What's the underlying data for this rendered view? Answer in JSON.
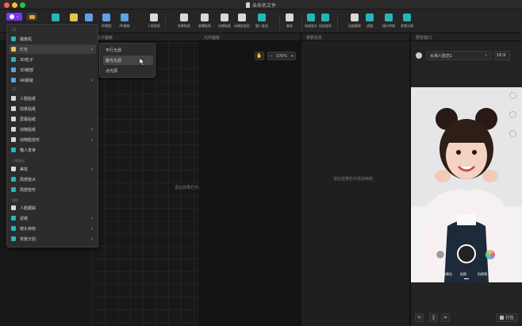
{
  "window": {
    "title": "未命名文件"
  },
  "toolbar": {
    "items": [
      {
        "label": "",
        "color": "#27b6b8"
      },
      {
        "label": "",
        "color": "#e0c64f"
      },
      {
        "label": "3D对象",
        "color": "#5fa0e6"
      },
      {
        "label": "3D模型",
        "color": "#5fa0e6"
      },
      {
        "label": "AR服装",
        "color": "#5fa0e6"
      },
      {
        "label": "人脸贴纸",
        "color": "#d8d8d8"
      },
      {
        "label": "前景贴纸",
        "color": "#d8d8d8"
      },
      {
        "label": "屏幕贴纸",
        "color": "#d8d8d8"
      },
      {
        "label": "动物贴纸",
        "color": "#d8d8d8"
      },
      {
        "label": "动物脸变形",
        "color": "#d8d8d8"
      },
      {
        "label": "猫人变身",
        "color": "#27b6b8"
      },
      {
        "label": "美妆",
        "color": "#d8d8d8"
      },
      {
        "label": "局部放大",
        "color": "#27b6b8"
      },
      {
        "label": "局部变形",
        "color": "#27b6b8"
      },
      {
        "label": "局部跟踪",
        "color": "#d8d8d8"
      },
      {
        "label": "滤镜",
        "color": "#27b6b8"
      },
      {
        "label": "镜头特效",
        "color": "#27b6b8"
      },
      {
        "label": "背景分割",
        "color": "#27b6b8"
      }
    ]
  },
  "panels": {
    "design": {
      "title": "设计面板",
      "empty": "请在效果栏中添加特效"
    },
    "element": {
      "title": "元件面板"
    },
    "params": {
      "title": "参数信息",
      "empty": "请在效果栏中添加特效"
    },
    "preview": {
      "title": "预览窗口",
      "selected": "女演人脸恋1",
      "ratio": "16:9"
    }
  },
  "zoom": {
    "value": "100%",
    "minus": "−",
    "plus": "+"
  },
  "menu": {
    "groups": [
      "2D",
      "3D",
      "人物美化",
      "跟踪"
    ],
    "items": [
      {
        "label": "摄像机",
        "color": "#27b6b8",
        "arrow": false
      },
      {
        "label": "灯光",
        "color": "#e0c64f",
        "arrow": true
      },
      {
        "label": "3D粒子",
        "color": "#27b6b8",
        "arrow": false
      },
      {
        "label": "3D眼部",
        "color": "#5fa0e6",
        "arrow": false
      },
      {
        "label": "AR服装",
        "color": "#5fa0e6",
        "arrow": true
      },
      {
        "label": "人脸贴纸",
        "color": "#d8d8d8",
        "arrow": false
      },
      {
        "label": "前景贴纸",
        "color": "#d8d8d8",
        "arrow": false
      },
      {
        "label": "屏幕贴纸",
        "color": "#d8d8d8",
        "arrow": false
      },
      {
        "label": "动物贴纸",
        "color": "#d8d8d8",
        "arrow": true
      },
      {
        "label": "动物脸变形",
        "color": "#d8d8d8",
        "arrow": true
      },
      {
        "label": "猫人变身",
        "color": "#27b6b8",
        "arrow": false
      },
      {
        "label": "美妆",
        "color": "#d8d8d8",
        "arrow": true
      },
      {
        "label": "局部放大",
        "color": "#27b6b8",
        "arrow": false
      },
      {
        "label": "局部变形",
        "color": "#27b6b8",
        "arrow": false
      },
      {
        "label": "人脸跟踪",
        "color": "#d8d8d8",
        "arrow": false
      },
      {
        "label": "滤镜",
        "color": "#27b6b8",
        "arrow": true
      },
      {
        "label": "镜头特效",
        "color": "#27b6b8",
        "arrow": true
      },
      {
        "label": "背景分割",
        "color": "#27b6b8",
        "arrow": true
      }
    ]
  },
  "submenu": {
    "items": [
      "平行光源",
      "聚光光源",
      "点光源"
    ]
  },
  "camera": {
    "modes": [
      "表情包",
      "拍照",
      "拍视频"
    ],
    "active": "拍照",
    "left_badge": "美颜"
  },
  "bottom": {
    "print_label": "打包"
  }
}
